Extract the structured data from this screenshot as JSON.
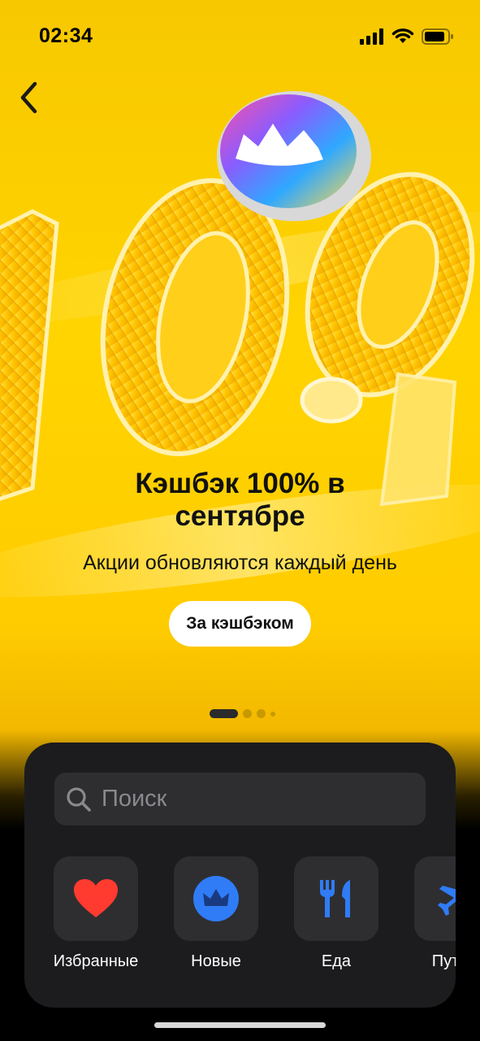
{
  "status_bar": {
    "time": "02:34"
  },
  "navigation": {
    "back_icon": "chevron-left-icon"
  },
  "promo": {
    "title": "Кэшбэк 100% в сентябре",
    "subtitle": "Акции обновляются каждый день",
    "button_label": "За кэшбэком"
  },
  "pager": {
    "total_pages": 4,
    "current_page": 1
  },
  "search": {
    "placeholder": "Поиск",
    "icon": "search-icon"
  },
  "categories": [
    {
      "label": "Избранные",
      "icon": "heart-icon",
      "color": "#ff3b30"
    },
    {
      "label": "Новые",
      "icon": "crown-icon",
      "color": "#2f7cf6"
    },
    {
      "label": "Еда",
      "icon": "fork-knife-icon",
      "color": "#2f7cf6"
    },
    {
      "label": "Путеш",
      "icon": "airplane-icon",
      "color": "#2f7cf6"
    }
  ],
  "colors": {
    "hero_yellow": "#ffd400",
    "sheet_bg": "#1c1c1e",
    "accent_blue": "#2f7cf6",
    "favorite_red": "#ff3b30"
  }
}
